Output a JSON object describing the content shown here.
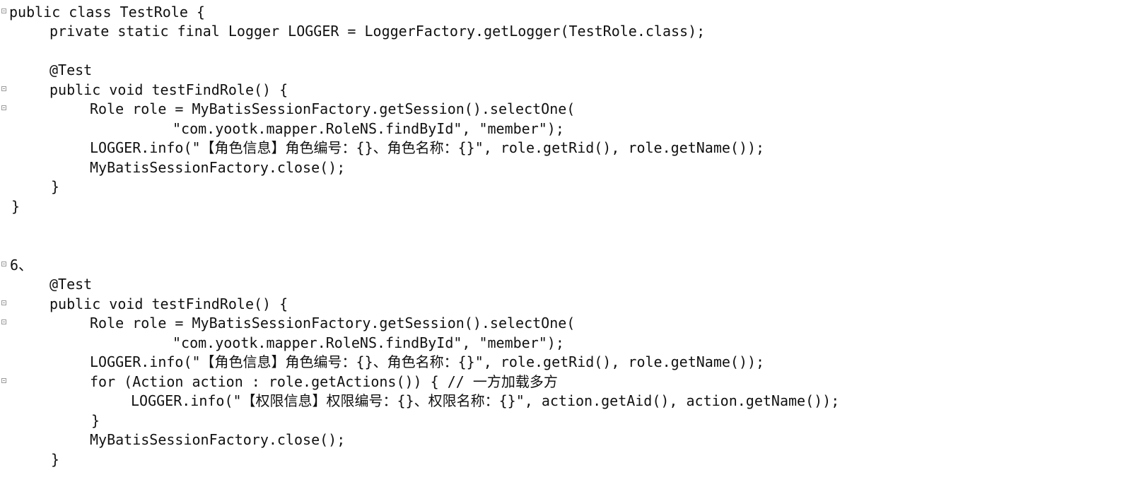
{
  "lines": [
    {
      "text": "public class TestRole {",
      "fold": true
    },
    {
      "text": "private static final Logger LOGGER = LoggerFactory.getLogger(TestRole.class);",
      "fold": false
    },
    {
      "text": "",
      "fold": false
    },
    {
      "text": "@Test",
      "fold": false
    },
    {
      "text": "public void testFindRole() {",
      "fold": true
    },
    {
      "text": "Role role = MyBatisSessionFactory.getSession().selectOne(",
      "fold": true
    },
    {
      "text": "\"com.yootk.mapper.RoleNS.findById\", \"member\");",
      "fold": false
    },
    {
      "text": "LOGGER.info(\"【角色信息】角色编号：{}、角色名称：{}\", role.getRid(), role.getName());",
      "fold": false
    },
    {
      "text": "MyBatisSessionFactory.close();",
      "fold": false
    },
    {
      "text": "}",
      "fold": false
    },
    {
      "text": "}",
      "fold": false
    },
    {
      "text": "",
      "fold": false
    },
    {
      "text": "",
      "fold": false
    },
    {
      "text": "6、",
      "fold": true
    },
    {
      "text": "@Test",
      "fold": false
    },
    {
      "text": "public void testFindRole() {",
      "fold": true
    },
    {
      "text": "Role role = MyBatisSessionFactory.getSession().selectOne(",
      "fold": true
    },
    {
      "text": "\"com.yootk.mapper.RoleNS.findById\", \"member\");",
      "fold": false
    },
    {
      "text": "LOGGER.info(\"【角色信息】角色编号：{}、角色名称：{}\", role.getRid(), role.getName());",
      "fold": false
    },
    {
      "text": "for (Action action : role.getActions()) { // 一方加载多方",
      "fold": true
    },
    {
      "text": "LOGGER.info(\"【权限信息】权限编号：{}、权限名称：{}\", action.getAid(), action.getName());",
      "fold": false
    },
    {
      "text": "}",
      "fold": false
    },
    {
      "text": "MyBatisSessionFactory.close();",
      "fold": false
    },
    {
      "text": "}",
      "fold": false
    }
  ]
}
